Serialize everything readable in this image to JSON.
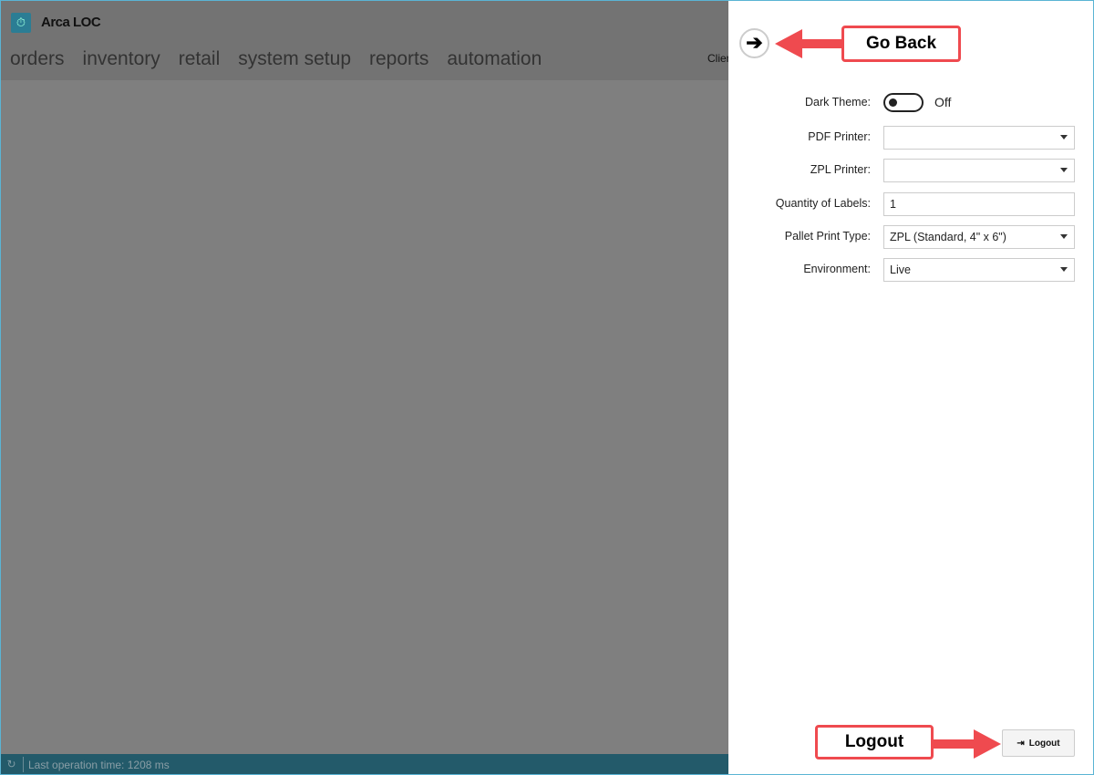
{
  "app": {
    "title": "Arca LOC",
    "client_label": "Clier"
  },
  "nav": [
    "orders",
    "inventory",
    "retail",
    "system setup",
    "reports",
    "automation"
  ],
  "status": {
    "text": "Last operation time:  1208 ms"
  },
  "panel": {
    "back_icon": "arrow-right-icon",
    "dark_theme": {
      "label": "Dark Theme:",
      "state": "Off",
      "on": false
    },
    "pdf_printer": {
      "label": "PDF Printer:",
      "value": ""
    },
    "zpl_printer": {
      "label": "ZPL Printer:",
      "value": ""
    },
    "quantity": {
      "label": "Quantity of Labels:",
      "value": "1"
    },
    "pallet_print_type": {
      "label": "Pallet Print Type:",
      "value": "ZPL (Standard, 4\" x 6\")"
    },
    "environment": {
      "label": "Environment:",
      "value": "Live"
    },
    "logout_label": "Logout"
  },
  "annotations": {
    "go_back": "Go Back",
    "logout": "Logout",
    "color": "#ef4a4f"
  }
}
